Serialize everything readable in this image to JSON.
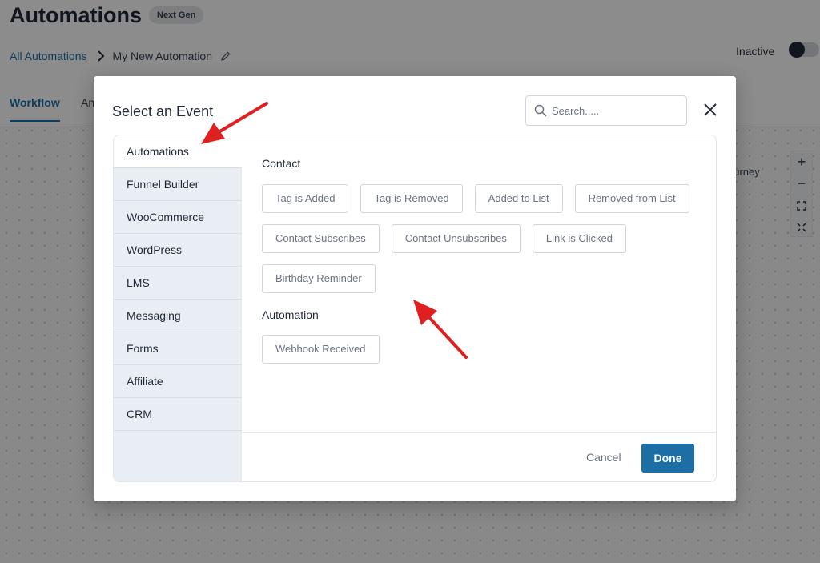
{
  "page": {
    "title": "Automations",
    "badge": "Next Gen",
    "breadcrumb": {
      "root": "All Automations",
      "current": "My New Automation"
    },
    "status": {
      "label": "Inactive",
      "active": false
    },
    "tabs": [
      "Workflow",
      "An"
    ],
    "canvas_text": "ourney",
    "zoom": {
      "in": "+",
      "out": "−"
    }
  },
  "modal": {
    "title": "Select an Event",
    "search": {
      "placeholder": "Search....."
    },
    "sidebar": [
      "Automations",
      "Funnel Builder",
      "WooCommerce",
      "WordPress",
      "LMS",
      "Messaging",
      "Forms",
      "Affiliate",
      "CRM"
    ],
    "sections": {
      "contact": {
        "title": "Contact",
        "events": [
          "Tag is Added",
          "Tag is Removed",
          "Added to List",
          "Removed from List",
          "Contact Subscribes",
          "Contact Unsubscribes",
          "Link is Clicked",
          "Birthday Reminder"
        ]
      },
      "automation": {
        "title": "Automation",
        "events": [
          "Webhook Received"
        ]
      }
    },
    "footer": {
      "cancel": "Cancel",
      "done": "Done"
    }
  },
  "colors": {
    "accent": "#1e6ea6",
    "annotation": "#e02020"
  }
}
